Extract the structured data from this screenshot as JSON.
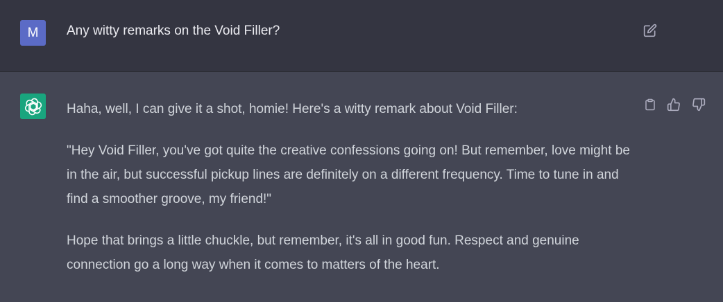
{
  "user_message": {
    "avatar_letter": "M",
    "text": "Any witty remarks on the Void Filler?",
    "edit_icon": "edit-icon"
  },
  "assistant_message": {
    "avatar_icon": "openai-logo-icon",
    "paragraphs": [
      "Haha, well, I can give it a shot, homie! Here's a witty remark about Void Filler:",
      "\"Hey Void Filler, you've got quite the creative confessions going on! But remember, love might be in the air, but successful pickup lines are definitely on a different frequency. Time to tune in and find a smoother groove, my friend!\"",
      "Hope that brings a little chuckle, but remember, it's all in good fun. Respect and genuine connection go a long way when it comes to matters of the heart."
    ],
    "actions": [
      "copy-icon",
      "thumbs-up-icon",
      "thumbs-down-icon"
    ]
  },
  "colors": {
    "user_bg": "#343541",
    "assistant_bg": "#444654",
    "user_avatar": "#5b6bc6",
    "bot_avatar": "#19a57e",
    "text": "#d1d5db",
    "icon": "#acacbe"
  }
}
